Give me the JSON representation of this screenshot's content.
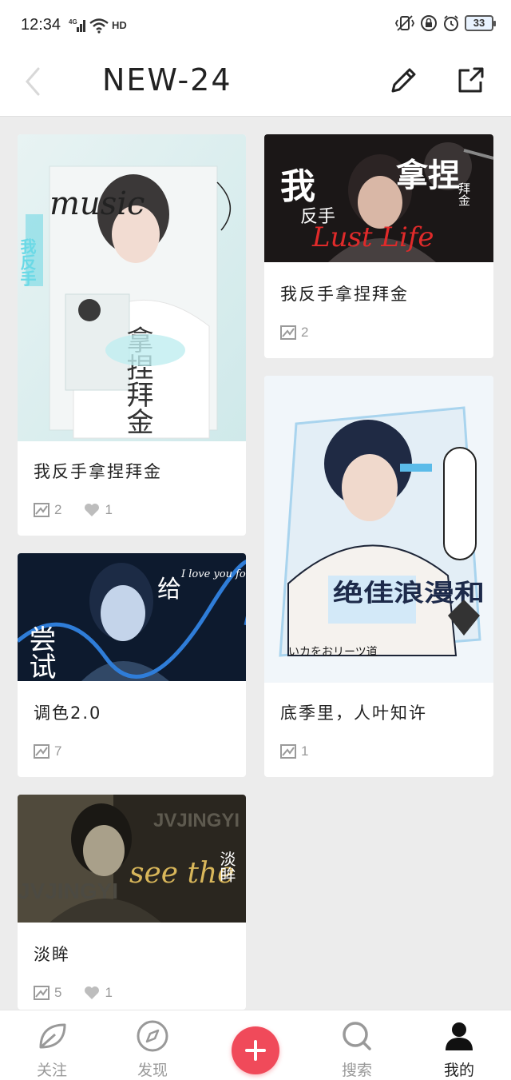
{
  "status_bar": {
    "time": "12:34",
    "network": "4G",
    "hd": "HD",
    "battery": "33"
  },
  "header": {
    "title": "NEW-24",
    "icons": [
      "back-icon",
      "edit-icon",
      "share-icon"
    ]
  },
  "cards": [
    {
      "title": "我反手拿捏拜金",
      "image_text": {
        "script": "music",
        "big": "拿捏拜金",
        "side": "我反手"
      },
      "images_count": "2",
      "likes": "1"
    },
    {
      "title": "我反手拿捏拜金",
      "image_text": {
        "left": "我",
        "mid": "反手",
        "big": "拿捏",
        "small": "拜金",
        "script": "Lust Life"
      },
      "images_count": "2"
    },
    {
      "title": "底季里，人叶知许",
      "image_text": {
        "big": "绝佳浪漫和",
        "jp": "いカをおリーツ道"
      },
      "images_count": "1"
    },
    {
      "title": "调色2.0",
      "image_text": {
        "left": "尝试",
        "mid": "给",
        "script": "I love you forever"
      },
      "images_count": "7"
    },
    {
      "title": "淡眸",
      "image_text": {
        "watermark": "JVJINGYI",
        "script": "see the",
        "vertical": "淡眸"
      },
      "images_count": "5",
      "likes": "1"
    }
  ],
  "bottom_nav": [
    {
      "label": "关注",
      "icon": "leaf-icon",
      "active": false
    },
    {
      "label": "发现",
      "icon": "compass-icon",
      "active": false
    },
    {
      "label": "",
      "icon": "add-icon",
      "active": false
    },
    {
      "label": "搜索",
      "icon": "search-icon",
      "active": false
    },
    {
      "label": "我的",
      "icon": "profile-icon",
      "active": true
    }
  ],
  "colors": {
    "accent": "#f04a5a",
    "background": "#ececec",
    "meta": "#9a9a9a"
  }
}
